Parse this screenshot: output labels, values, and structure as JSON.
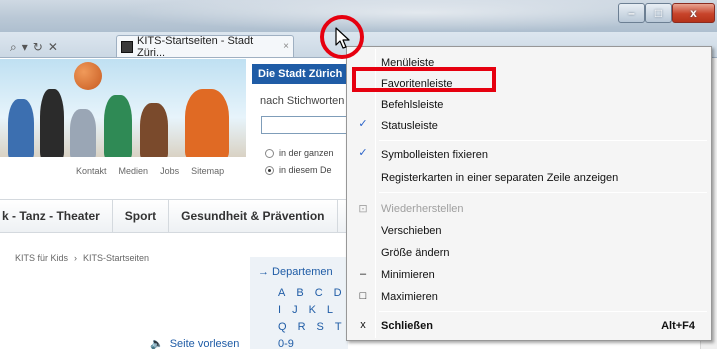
{
  "window": {
    "tab_title": "KITS-Startseiten - Stadt Züri...",
    "tab_close": "×",
    "favicon_text": "KITS",
    "controls": {
      "minimize": "–",
      "maximize": "□",
      "close": "x"
    },
    "addr_tools": [
      "⌕",
      "▾",
      "↻",
      "✕"
    ]
  },
  "page": {
    "header_links": [
      "Kontakt",
      "Medien",
      "Jobs",
      "Sitemap"
    ],
    "search_header": "Die Stadt Zürich",
    "search_label": "nach Stichworten",
    "radio_options": [
      {
        "label": "in der ganzen",
        "selected": false
      },
      {
        "label": "in diesem De",
        "selected": true
      }
    ],
    "nav_items": [
      "k - Tanz - Theater",
      "Sport",
      "Gesundheit & Prävention"
    ],
    "breadcrumb": [
      "KITS für Kids",
      "›",
      "KITS-Startseiten"
    ],
    "departments_title": "→ Departemen",
    "alphabet_rows": [
      [
        "A",
        "B",
        "C",
        "D"
      ],
      [
        "I",
        "J",
        "K",
        "L"
      ],
      [
        "Q",
        "R",
        "S",
        "T"
      ],
      [
        "0-9"
      ]
    ],
    "read_aloud": "Seite vorlesen"
  },
  "context_menu": {
    "items": [
      {
        "label": "Menüleiste",
        "glyph": "",
        "state": "normal"
      },
      {
        "label": "Favoritenleiste",
        "glyph": "",
        "state": "highlighted"
      },
      {
        "label": "Befehlsleiste",
        "glyph": "",
        "state": "normal"
      },
      {
        "label": "Statusleiste",
        "glyph": "✓",
        "state": "checked"
      },
      {
        "label": "Symbolleisten fixieren",
        "glyph": "✓",
        "state": "checked"
      },
      {
        "label": "Registerkarten in einer separaten Zeile anzeigen",
        "glyph": "",
        "state": "normal"
      },
      {
        "label": "Wiederherstellen",
        "glyph": "⊡",
        "state": "disabled"
      },
      {
        "label": "Verschieben",
        "glyph": "",
        "state": "normal"
      },
      {
        "label": "Größe ändern",
        "glyph": "",
        "state": "normal"
      },
      {
        "label": "Minimieren",
        "glyph": "–",
        "state": "normal"
      },
      {
        "label": "Maximieren",
        "glyph": "□",
        "state": "normal"
      },
      {
        "label": "Schließen",
        "glyph": "x",
        "state": "bold",
        "shortcut": "Alt+F4"
      }
    ]
  },
  "colors": {
    "highlight_red": "#e6000f",
    "brand_blue": "#1f5ca6",
    "check_blue": "#2a63c9"
  }
}
